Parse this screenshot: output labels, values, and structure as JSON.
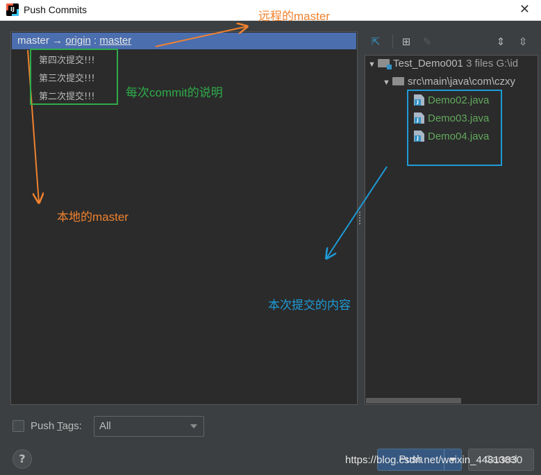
{
  "window": {
    "title": "Push Commits"
  },
  "branch": {
    "local": "master",
    "arrow": "→",
    "remote": "origin",
    "separator": ":",
    "remote_branch": "master"
  },
  "commits": [
    "第四次提交!!!",
    "第三次提交!!!",
    "第二次提交!!!"
  ],
  "tree": {
    "root": {
      "name": "Test_Demo001",
      "count": "3 files",
      "path": "G:\\id"
    },
    "folder": {
      "name": "src\\main\\java\\com\\czxy"
    },
    "files": [
      "Demo02.java",
      "Demo03.java",
      "Demo04.java"
    ]
  },
  "push_tags": {
    "label_prefix": "Push ",
    "label_mnemonic": "T",
    "label_suffix": "ags:",
    "selected": "All"
  },
  "buttons": {
    "push": "Push",
    "cancel": "Cancel",
    "help": "?"
  },
  "annotations": {
    "remote_master": "远程的master",
    "commit_desc": "每次commit的说明",
    "local_master": "本地的master",
    "commit_content": "本次提交的内容"
  },
  "annotation_colors": {
    "orange": "#f0822e",
    "green": "#2eac4a",
    "blue": "#1e9bd7"
  },
  "watermark": "https://blog.csdn.net/weixin_44813830"
}
